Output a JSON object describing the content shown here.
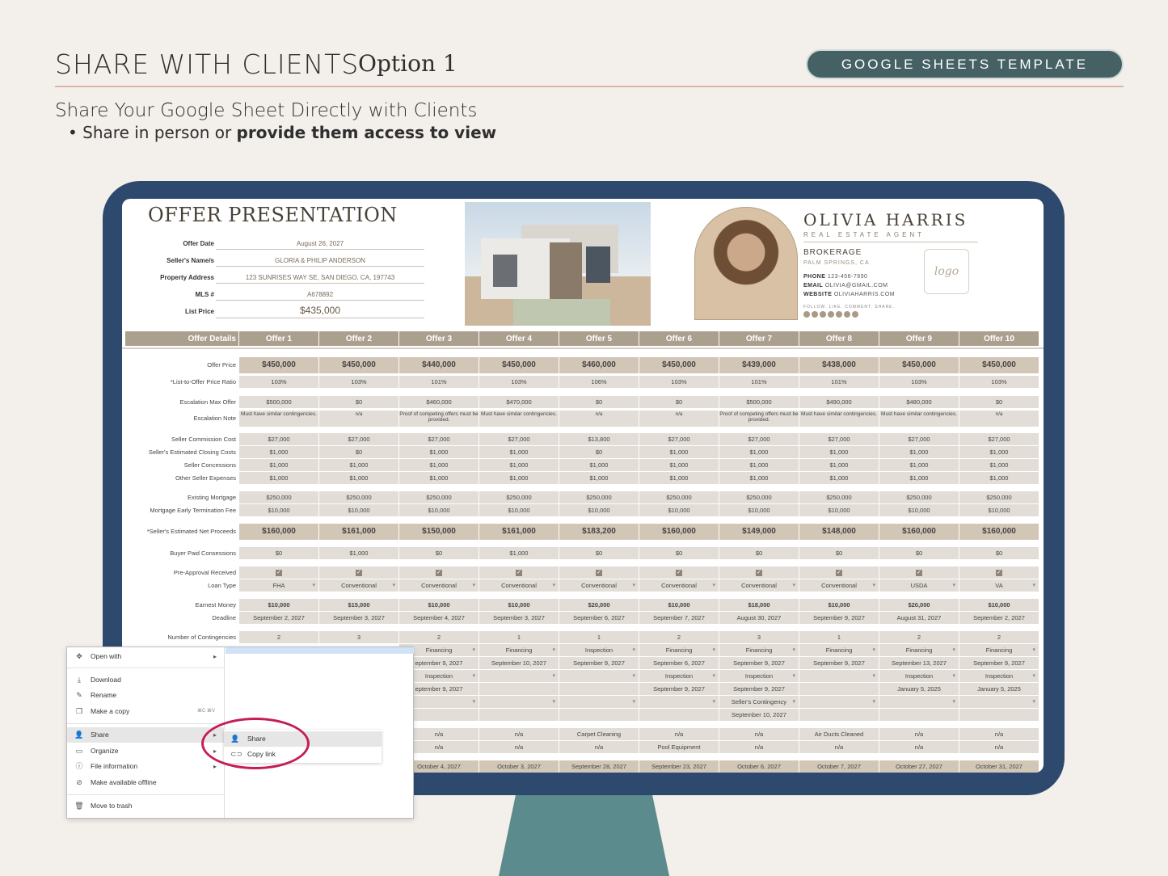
{
  "header": {
    "title": "SHARE WITH CLIENTS",
    "option": "Option 1",
    "pill": "GOOGLE SHEETS TEMPLATE",
    "subtitle": "Share Your Google Sheet Directly with Clients",
    "bullet_prefix": "Share in person or ",
    "bullet_bold": "provide them access to view"
  },
  "colors": {
    "pill": "#466163",
    "monitor": "#2d4a6e",
    "stand": "#5b8b8c",
    "highlight_circle": "#c41e55",
    "table_header": "#ab9f8d"
  },
  "offer": {
    "title": "OFFER PRESENTATION",
    "fields": [
      {
        "label": "Offer Date",
        "value": "August 26, 2027"
      },
      {
        "label": "Seller's Name/s",
        "value": "GLORIA & PHILIP ANDERSON"
      },
      {
        "label": "Property Address",
        "value": "123 SUNRISES WAY SE, SAN DIEGO, CA, 197743"
      },
      {
        "label": "MLS #",
        "value": "A678892"
      },
      {
        "label": "List Price",
        "value": "$435,000"
      }
    ]
  },
  "agent": {
    "name": "OLIVIA HARRIS",
    "role": "REAL ESTATE AGENT",
    "brokerage": "BROKERAGE",
    "city": "PALM SPRINGS, CA",
    "phone_label": "PHONE",
    "phone": "123-456-7890",
    "email_label": "EMAIL",
    "email": "OLIVIA@GMAIL.COM",
    "website_label": "WEBSITE",
    "website": "OLIVIAHARRIS.COM",
    "follow": "FOLLOW. LIKE. COMMENT. SHARE.",
    "logo": "logo"
  },
  "table": {
    "corner": "Offer Details",
    "columns": [
      "Offer 1",
      "Offer 2",
      "Offer 3",
      "Offer 4",
      "Offer 5",
      "Offer 6",
      "Offer 7",
      "Offer 8",
      "Offer 9",
      "Offer 10"
    ],
    "rows": [
      {
        "label": "Offer Price",
        "kind": "tall",
        "values": [
          "$450,000",
          "$450,000",
          "$440,000",
          "$450,000",
          "$460,000",
          "$450,000",
          "$439,000",
          "$438,000",
          "$450,000",
          "$450,000"
        ]
      },
      {
        "label": "*List-to-Offer Price Ratio",
        "values": [
          "103%",
          "103%",
          "101%",
          "103%",
          "106%",
          "103%",
          "101%",
          "101%",
          "103%",
          "103%"
        ]
      },
      {
        "label": "Escalation Max Offer",
        "values": [
          "$500,000",
          "$0",
          "$460,000",
          "$470,000",
          "$0",
          "$0",
          "$500,000",
          "$490,000",
          "$480,000",
          "$0"
        ]
      },
      {
        "label": "Escalation Note",
        "kind": "note",
        "values": [
          "Must have similar contingencies.",
          "n/a",
          "Proof of competing offers must be provided.",
          "Must have similar contingencies.",
          "n/a",
          "n/a",
          "Proof of competing offers must be provided.",
          "Must have similar contingencies.",
          "Must have similar contingencies.",
          "n/a"
        ]
      },
      {
        "label": "Seller Commission Cost",
        "values": [
          "$27,000",
          "$27,000",
          "$27,000",
          "$27,000",
          "$13,800",
          "$27,000",
          "$27,000",
          "$27,000",
          "$27,000",
          "$27,000"
        ]
      },
      {
        "label": "Seller's Estimated Closing Costs",
        "values": [
          "$1,000",
          "$0",
          "$1,000",
          "$1,000",
          "$0",
          "$1,000",
          "$1,000",
          "$1,000",
          "$1,000",
          "$1,000"
        ]
      },
      {
        "label": "Seller Concessions",
        "values": [
          "$1,000",
          "$1,000",
          "$1,000",
          "$1,000",
          "$1,000",
          "$1,000",
          "$1,000",
          "$1,000",
          "$1,000",
          "$1,000"
        ]
      },
      {
        "label": "Other Seller Expenses",
        "values": [
          "$1,000",
          "$1,000",
          "$1,000",
          "$1,000",
          "$1,000",
          "$1,000",
          "$1,000",
          "$1,000",
          "$1,000",
          "$1,000"
        ]
      },
      {
        "label": "Existing Mortgage",
        "values": [
          "$250,000",
          "$250,000",
          "$250,000",
          "$250,000",
          "$250,000",
          "$250,000",
          "$250,000",
          "$250,000",
          "$250,000",
          "$250,000"
        ]
      },
      {
        "label": "Mortgage Early Termination Fee",
        "values": [
          "$10,000",
          "$10,000",
          "$10,000",
          "$10,000",
          "$10,000",
          "$10,000",
          "$10,000",
          "$10,000",
          "$10,000",
          "$10,000"
        ]
      },
      {
        "label": "*Seller's Estimated Net Proceeds",
        "kind": "tall",
        "values": [
          "$160,000",
          "$161,000",
          "$150,000",
          "$161,000",
          "$183,200",
          "$160,000",
          "$149,000",
          "$148,000",
          "$160,000",
          "$160,000"
        ]
      },
      {
        "label": "Buyer Paid Consessions",
        "values": [
          "$0",
          "$1,000",
          "$0",
          "$1,000",
          "$0",
          "$0",
          "$0",
          "$0",
          "$0",
          "$0"
        ]
      },
      {
        "label": "Pre-Approval Received",
        "kind": "check",
        "values": [
          "✓",
          "✓",
          "✓",
          "✓",
          "✓",
          "✓",
          "✓",
          "✓",
          "✓",
          "✓"
        ]
      },
      {
        "label": "Loan Type",
        "kind": "dd",
        "values": [
          "FHA",
          "Conventional",
          "Conventional",
          "Conventional",
          "Conventional",
          "Conventional",
          "Conventional",
          "Conventional",
          "USDA",
          "VA"
        ]
      },
      {
        "label": "Earnest Money",
        "kind": "bold",
        "values": [
          "$10,000",
          "$15,000",
          "$10,000",
          "$10,000",
          "$20,000",
          "$10,000",
          "$18,000",
          "$10,000",
          "$20,000",
          "$10,000"
        ]
      },
      {
        "label": "Deadline",
        "values": [
          "September 2, 2027",
          "September 3, 2027",
          "September 4, 2027",
          "September 3, 2027",
          "September 6, 2027",
          "September 7, 2027",
          "August 30, 2027",
          "September 9, 2027",
          "August 31, 2027",
          "September 2, 2027"
        ]
      },
      {
        "label": "Number of Contingencies",
        "values": [
          "2",
          "3",
          "2",
          "1",
          "1",
          "2",
          "3",
          "1",
          "2",
          "2"
        ]
      }
    ],
    "hidden_rows": [
      {
        "kind": "dd",
        "values": [
          "Financing",
          "Financing",
          "Inspection",
          "Financing",
          "Financing",
          "Financing",
          "Financing",
          "Financing"
        ]
      },
      {
        "values": [
          "eptember 9, 2027",
          "September 10, 2027",
          "September 9, 2027",
          "September 6, 2027",
          "September 9, 2027",
          "September 9, 2027",
          "September 13, 2027",
          "September 9, 2027"
        ]
      },
      {
        "kind": "dd",
        "values": [
          "Inspection",
          "",
          "",
          "Inspection",
          "Inspection",
          "",
          "Inspection",
          "Inspection"
        ]
      },
      {
        "values": [
          "eptember 9, 2027",
          "",
          "",
          "September 9, 2027",
          "September 9, 2027",
          "",
          "January 5, 2025",
          "January 5, 2025"
        ]
      },
      {
        "kind": "dd",
        "values": [
          "",
          "",
          "",
          "",
          "Seller's Contingency",
          "",
          "",
          ""
        ]
      },
      {
        "values": [
          "",
          "",
          "",
          "",
          "September 10, 2027",
          "",
          "",
          ""
        ]
      },
      {
        "values": [
          "n/a",
          "n/a",
          "Carpet Cleaning",
          "n/a",
          "n/a",
          "Air Ducts Cleaned",
          "n/a",
          "n/a"
        ]
      },
      {
        "values": [
          "n/a",
          "n/a",
          "n/a",
          "Pool Equipment",
          "n/a",
          "n/a",
          "n/a",
          "n/a"
        ]
      },
      {
        "kind": "closing",
        "values": [
          "October 4, 2027",
          "October 3, 2027",
          "September 28, 2027",
          "September 23, 2027",
          "October 6, 2027",
          "October 7, 2027",
          "October 27, 2027",
          "October 31, 2027"
        ]
      }
    ]
  },
  "context_menu": {
    "items": [
      {
        "label": "Open with",
        "icon": "move-icon",
        "glyph": "✥",
        "arrow": "▸"
      },
      {
        "label": "Download",
        "icon": "download-icon",
        "glyph": "⤓"
      },
      {
        "label": "Rename",
        "icon": "pencil-icon",
        "glyph": "✎"
      },
      {
        "label": "Make a copy",
        "icon": "copy-icon",
        "glyph": "❐",
        "shortcut": "⌘C ⌘V"
      },
      {
        "label": "Share",
        "icon": "person-add-icon",
        "glyph": "👤",
        "arrow": "▸"
      },
      {
        "label": "Organize",
        "icon": "folder-icon",
        "glyph": "▭",
        "arrow": "▸"
      },
      {
        "label": "File information",
        "icon": "info-icon",
        "glyph": "ⓘ",
        "arrow": "▸"
      },
      {
        "label": "Make available offline",
        "icon": "offline-icon",
        "glyph": "⊘"
      },
      {
        "label": "Move to trash",
        "icon": "trash-icon",
        "glyph": "🗑"
      }
    ],
    "submenu": [
      {
        "label": "Share",
        "icon": "person-add-icon",
        "glyph": "👤"
      },
      {
        "label": "Copy link",
        "icon": "link-icon",
        "glyph": "⊂⊃"
      }
    ]
  }
}
